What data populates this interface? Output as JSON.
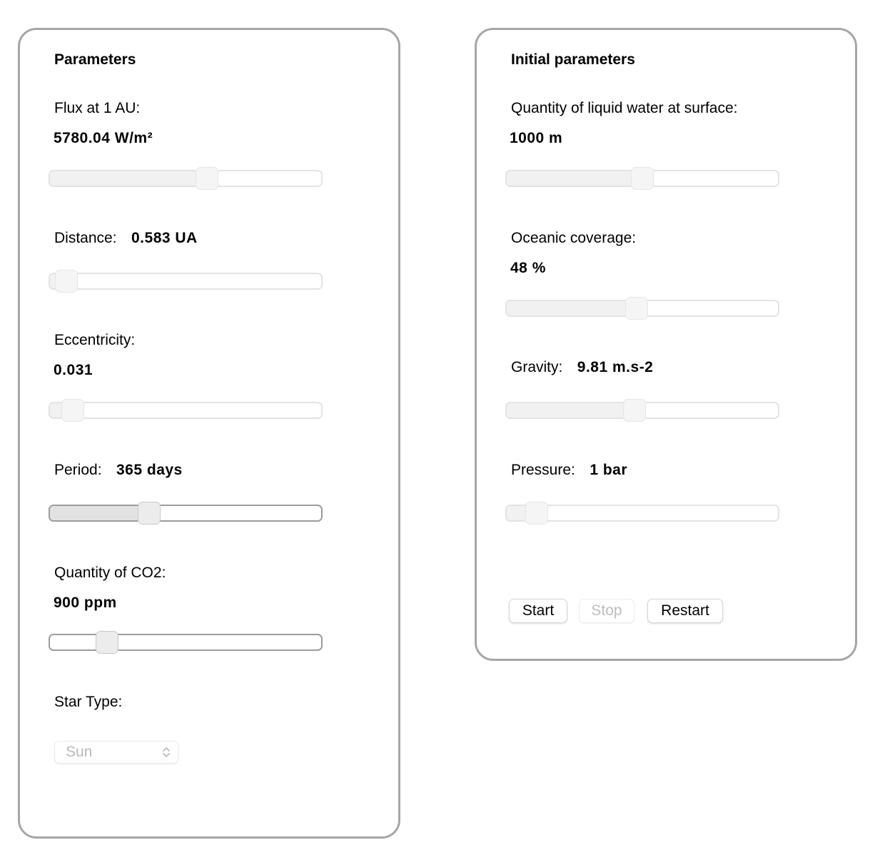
{
  "parameters": {
    "title": "Parameters",
    "flux": {
      "label": "Flux at 1 AU:",
      "value": "5780.04 W/m²",
      "slider_fraction": 0.58
    },
    "distance": {
      "label": "Distance:",
      "value": "0.583 UA",
      "slider_fraction": 0.06
    },
    "eccentricity": {
      "label": "Eccentricity:",
      "value": "0.031",
      "slider_fraction": 0.085
    },
    "period": {
      "label": "Period:",
      "value": "365 days",
      "slider_fraction": 0.365
    },
    "co2": {
      "label": "Quantity of CO2:",
      "value": "900 ppm",
      "slider_fraction": 0.21
    },
    "star_type": {
      "label": "Star Type:",
      "selected": "Sun"
    }
  },
  "initial_parameters": {
    "title": "Initial parameters",
    "water": {
      "label": "Quantity of liquid water at surface:",
      "value": "1000 m",
      "slider_fraction": 0.5
    },
    "ocean": {
      "label": "Oceanic coverage:",
      "value": "48 %",
      "slider_fraction": 0.48
    },
    "gravity": {
      "label": "Gravity:",
      "value": "9.81 m.s-2",
      "slider_fraction": 0.47
    },
    "pressure": {
      "label": "Pressure:",
      "value": "1 bar",
      "slider_fraction": 0.11
    }
  },
  "controls": {
    "start_label": "Start",
    "stop_label": "Stop",
    "restart_label": "Restart"
  }
}
